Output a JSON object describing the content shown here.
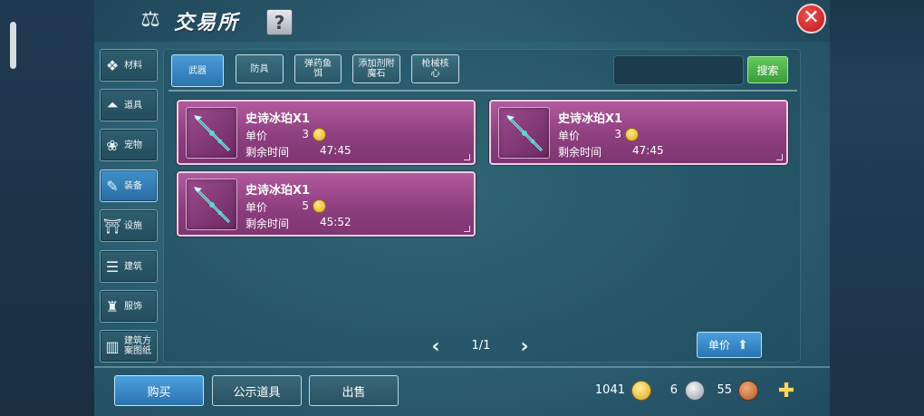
{
  "header": {
    "title": "交易所",
    "help_label": "?",
    "close_label": "✕"
  },
  "categories": [
    {
      "label": "材料",
      "icon": "material-icon",
      "glyph": "❖",
      "active": false
    },
    {
      "label": "道具",
      "icon": "tool-icon",
      "glyph": "⏶",
      "active": false
    },
    {
      "label": "宠物",
      "icon": "paw-icon",
      "glyph": "❀",
      "active": false
    },
    {
      "label": "装备",
      "icon": "equipment-icon",
      "glyph": "✎",
      "active": true
    },
    {
      "label": "设施",
      "icon": "facility-icon",
      "glyph": "⛩",
      "active": false
    },
    {
      "label": "建筑",
      "icon": "building-icon",
      "glyph": "☰",
      "active": false
    },
    {
      "label": "服饰",
      "icon": "clothing-icon",
      "glyph": "♜",
      "active": false
    },
    {
      "label": "建筑方案图纸",
      "icon": "blueprint-icon",
      "glyph": "▥",
      "active": false
    }
  ],
  "tabs": [
    {
      "label": "武器",
      "active": true
    },
    {
      "label": "防具",
      "active": false
    },
    {
      "label": "弹药鱼饵",
      "active": false
    },
    {
      "label": "添加剂附魔石",
      "active": false
    },
    {
      "label": "枪械核心",
      "active": false
    }
  ],
  "search": {
    "placeholder": "",
    "button_label": "搜索"
  },
  "listings": [
    {
      "name": "史诗冰珀X1",
      "price_label": "单价",
      "price": "3",
      "time_label": "剩余时间",
      "time": "47:45"
    },
    {
      "name": "史诗冰珀X1",
      "price_label": "单价",
      "price": "3",
      "time_label": "剩余时间",
      "time": "47:45"
    },
    {
      "name": "史诗冰珀X1",
      "price_label": "单价",
      "price": "5",
      "time_label": "剩余时间",
      "time": "45:52"
    }
  ],
  "pagination": {
    "prev": "‹",
    "next": "›",
    "indicator": "1/1"
  },
  "sort": {
    "label": "单价"
  },
  "bottom_actions": {
    "buy": "购买",
    "showcase": "公示道具",
    "sell": "出售"
  },
  "currency": {
    "gold": "1041",
    "silver": "6",
    "copper": "55"
  },
  "colors": {
    "card": "#8d3f7f",
    "accent_blue": "#2b74b0",
    "search_green": "#3b9c39",
    "close_red": "#b61a1a"
  }
}
